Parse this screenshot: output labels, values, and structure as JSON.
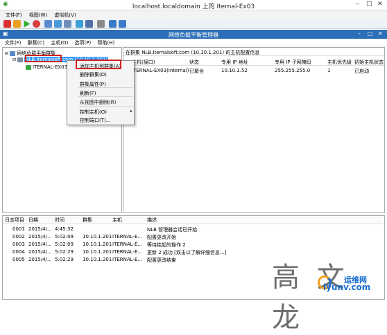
{
  "vm": {
    "title": "localhost.localdomain 上的 Iternal-Ex03",
    "menu": [
      "文件(F)",
      "视图(W)",
      "虚拟机(V)"
    ]
  },
  "nlb": {
    "title": "网络负载平衡管理器",
    "menu": [
      "文件(F)",
      "群集(C)",
      "主机(O)",
      "选项(P)",
      "帮助(H)"
    ]
  },
  "tree": {
    "root": "网络负载平衡群集",
    "cluster": "NLB.Iternalsoft.com (10.10.1.201)",
    "host": "ITERNAL-EX03("
  },
  "context_menu": {
    "items": [
      "添加主机到群集(A)",
      "删除群集(D)",
      "群集属性(P)",
      "刷新(F)",
      "从视图中删除(R)",
      "控制主机(O)",
      "控制端口(T)..."
    ]
  },
  "right_pane": {
    "header": "在群集 NLB.Iternalsoft.com (10.10.1.201) 的主机配置信息",
    "columns": [
      "主机(接口)",
      "状态",
      "专用 IP 地址",
      "专用 IP 子网掩码",
      "主机优先级",
      "初始主机状态"
    ],
    "rows": [
      [
        "ITERNAL-EX03(Internal)",
        "已聚合",
        "10.10.1.52",
        "255.255.255.0",
        "1",
        "已启动"
      ]
    ]
  },
  "log": {
    "columns": [
      "日志项目",
      "日期",
      "时间",
      "群集",
      "主机",
      "描述"
    ],
    "rows": [
      [
        "0001",
        "2015/4/...",
        "4:45:32",
        "",
        "",
        "NLB 管理器会话已开始"
      ],
      [
        "0002",
        "2015/4/...",
        "5:02:09",
        "10.10.1.201",
        "ITERNAL-E...",
        "配置更改开始"
      ],
      [
        "0003",
        "2015/4/...",
        "5:02:09",
        "10.10.1.201",
        "ITERNAL-E...",
        "等待挂起的操作 2"
      ],
      [
        "0004",
        "2015/4/...",
        "5:02:29",
        "10.10.1.201",
        "ITERNAL-E...",
        "更新 2 成功 [双击以了解详细信息...]"
      ],
      [
        "0005",
        "2015/4/...",
        "5:02:29",
        "10.10.1.201",
        "ITERNAL-E...",
        "配置更改结束"
      ]
    ]
  },
  "watermark": {
    "text": "高 文 龙",
    "logo_text": "iyunv.com",
    "logo_cn": "运维网"
  },
  "colors": {
    "nlb_title_bar": "#2c6fb8",
    "highlight": "#d02020",
    "selection": "#3399ff"
  }
}
